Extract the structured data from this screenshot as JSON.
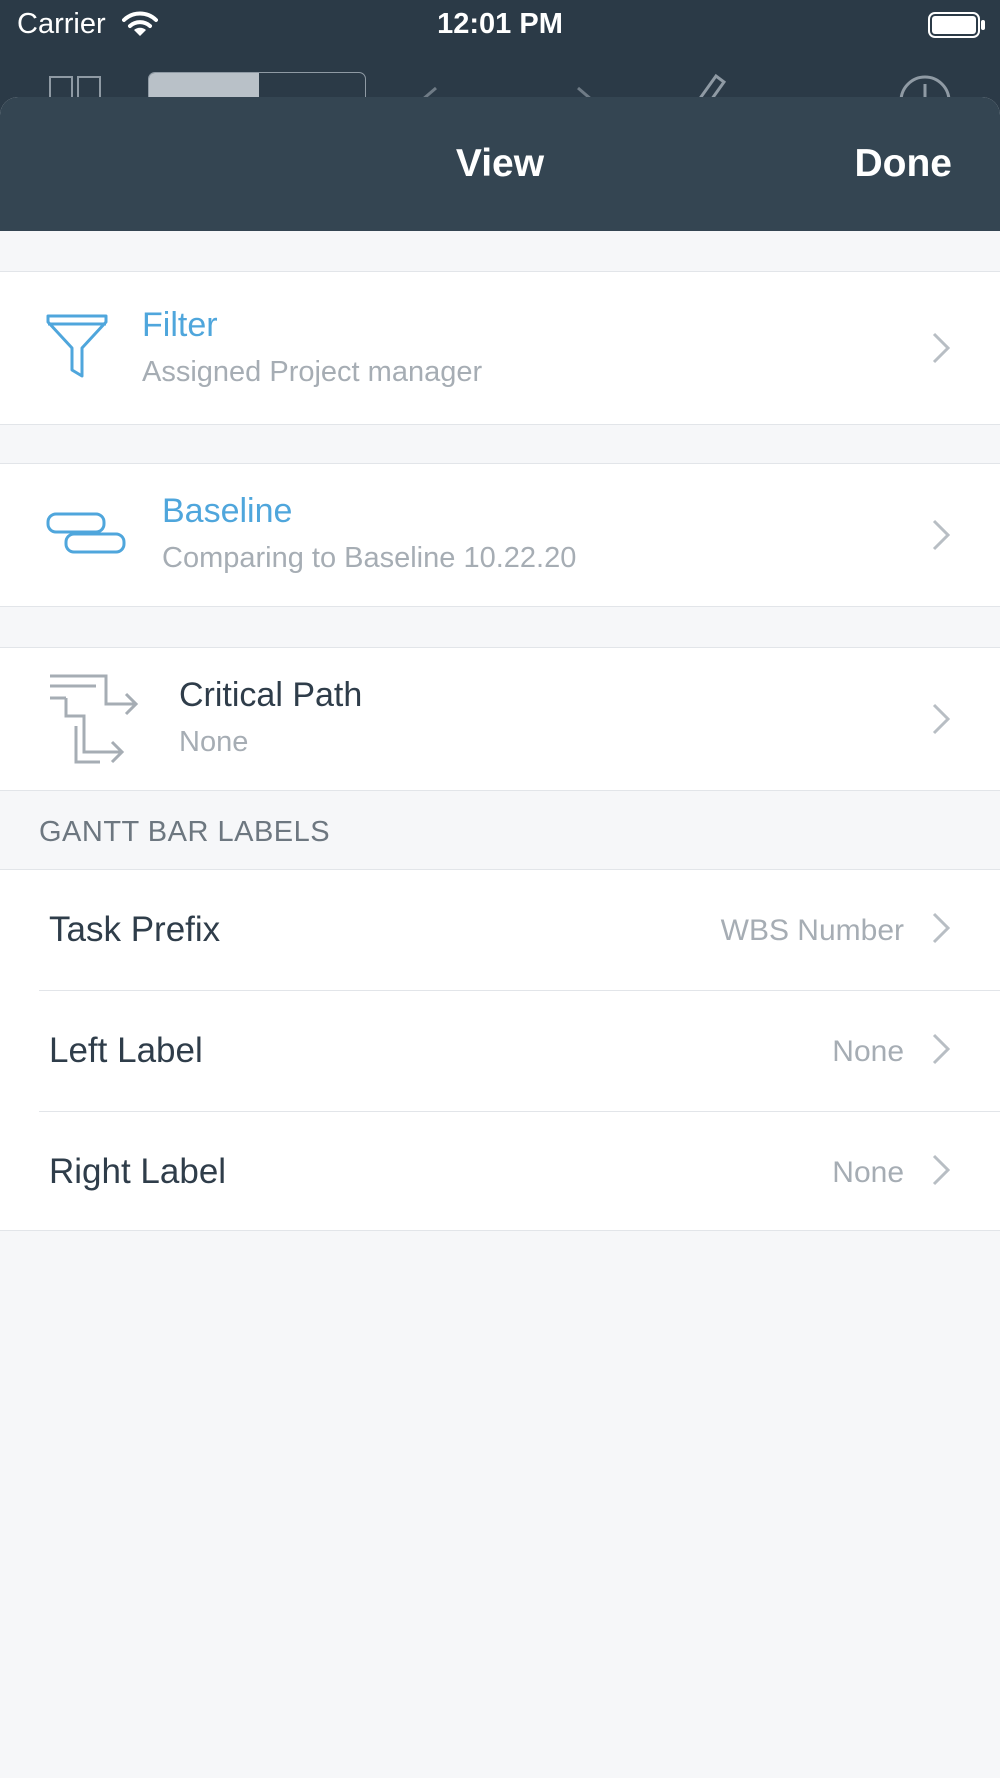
{
  "status_bar": {
    "carrier": "Carrier",
    "time": "12:01 PM"
  },
  "navbar": {
    "title": "View",
    "done_label": "Done"
  },
  "rows": {
    "filter": {
      "title": "Filter",
      "subtitle": "Assigned Project manager",
      "icon": "funnel-icon"
    },
    "baseline": {
      "title": "Baseline",
      "subtitle": "Comparing to Baseline 10.22.20",
      "icon": "baseline-bars-icon"
    },
    "critical_path": {
      "title": "Critical Path",
      "subtitle": "None",
      "icon": "critical-path-icon"
    }
  },
  "gantt_section": {
    "header": "GANTT BAR LABELS",
    "items": [
      {
        "label": "Task Prefix",
        "value": "WBS Number"
      },
      {
        "label": "Left Label",
        "value": "None"
      },
      {
        "label": "Right Label",
        "value": "None"
      }
    ]
  },
  "colors": {
    "accent": "#4fa6dc",
    "navbar": "#344552",
    "background": "#f6f7f9"
  }
}
